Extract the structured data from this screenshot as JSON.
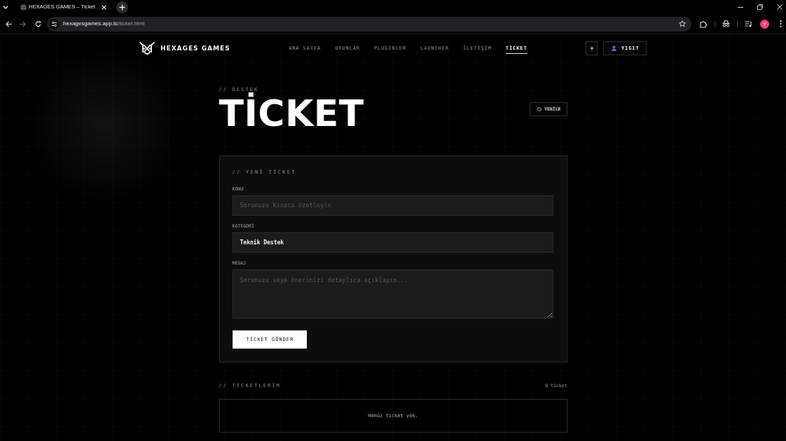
{
  "browser": {
    "tab_title": "HEXAGES GAMES – Ticket",
    "url_host": "hexagesgames.app.tc",
    "url_path": "/ticket.html",
    "profile_initial": "Y"
  },
  "nav": {
    "brand": "HEXAGES GAMES",
    "links": [
      {
        "label": "ANA SAYFA",
        "selected": false
      },
      {
        "label": "OYUNLAR",
        "selected": false
      },
      {
        "label": "PLUGINLER",
        "selected": false
      },
      {
        "label": "LAUNCHER",
        "selected": false
      },
      {
        "label": "İLETİŞİM",
        "selected": false
      },
      {
        "label": "TİCKET",
        "selected": true
      }
    ],
    "user_button": "YIGIT"
  },
  "header": {
    "eyebrow": "// DESTEK",
    "title": "TİCKET",
    "refresh_button": "YENİLE"
  },
  "form": {
    "title": "// YENİ TİCKET",
    "fields": [
      {
        "kind": "input",
        "label": "KONU",
        "placeholder": "Sorunuzu kısaca özetleyin"
      },
      {
        "kind": "select",
        "label": "KATEGORİ",
        "value": "Teknik Destek"
      },
      {
        "kind": "textarea",
        "label": "MESAJ",
        "placeholder": "Sorunuzu veya önerinizi detaylıca açıklayın..."
      }
    ],
    "submit_button": "TİCKET GÖNDER"
  },
  "tickets": {
    "title": "// TİCKETLERİM",
    "count": "0 ticket",
    "empty_message": "Henüz ticket yok."
  }
}
